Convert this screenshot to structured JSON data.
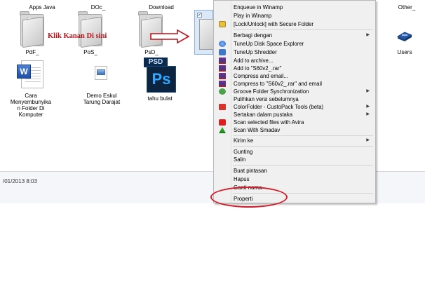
{
  "top_labels": [
    "Apps Java",
    "DOc_",
    "Download",
    "Other_"
  ],
  "folders": [
    {
      "label": "PdF_"
    },
    {
      "label": "PoS_"
    },
    {
      "label": "PsD_"
    }
  ],
  "files": [
    {
      "label": "Cara Menyembunyikan Folder Di Komputer",
      "line1": "Cara",
      "line2": "Menyembunyika",
      "line3": "n Folder Di",
      "line4": "Komputer"
    },
    {
      "label": "Demo Eskul Tarung Darajat",
      "line1": "Demo Eskul",
      "line2": "Tarung Darajat"
    },
    {
      "label": "tahu bulat",
      "badge": "PSD",
      "glyph": "Ps"
    }
  ],
  "users": {
    "label": "Users"
  },
  "status": {
    "text": "/01/2013 8:03"
  },
  "annotation": {
    "text": "Klik Kanan Di sini"
  },
  "context_menu": {
    "group1": [
      "Enqueue in Winamp",
      "Play in Winamp",
      "[Lock/Unlock] with Secure Folder"
    ],
    "group2": [
      {
        "label": "Berbagi dengan",
        "submenu": true
      },
      {
        "label": "TuneUp Disk Space Explorer"
      },
      {
        "label": "TuneUp Shredder"
      },
      {
        "label": "Add to archive..."
      },
      {
        "label": "Add to \"S60v2_.rar\""
      },
      {
        "label": "Compress and email..."
      },
      {
        "label": "Compress to \"S60v2_.rar\" and email"
      },
      {
        "label": "Groove Folder Synchronization",
        "submenu": true
      },
      {
        "label": "Pulihkan versi sebelumnya"
      },
      {
        "label": "ColorFolder - CustoPack Tools (beta)",
        "submenu": true
      },
      {
        "label": "Sertakan dalam pustaka",
        "submenu": true
      },
      {
        "label": "Scan selected files with Avira"
      },
      {
        "label": "Scan With Smadav"
      }
    ],
    "group3": [
      {
        "label": "Kirim ke",
        "submenu": true
      }
    ],
    "group4": [
      "Gunting",
      "Salin"
    ],
    "group5": [
      "Buat pintasan",
      "Hapus",
      "Ganti nama"
    ],
    "group6": [
      "Properti"
    ]
  },
  "colors": {
    "annotation": "#c0121a",
    "menu_bg": "#f0f0f0",
    "highlight": "#d21d2a"
  }
}
